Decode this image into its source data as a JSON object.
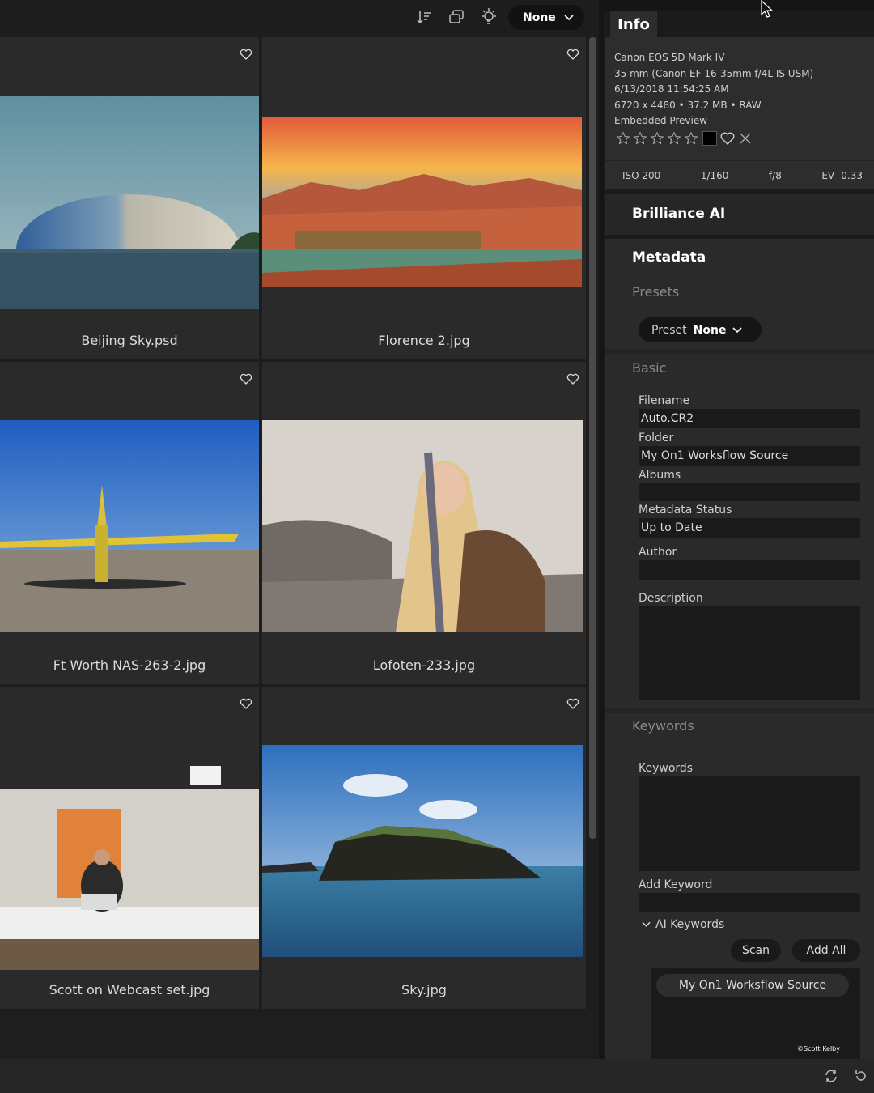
{
  "toolbar": {
    "sort_label": "None",
    "icons": [
      "sort-icon",
      "stack-icon",
      "lightbulb-icon",
      "chevron-down-icon"
    ]
  },
  "grid": {
    "items": [
      {
        "filename": "Beijing Sky.psd"
      },
      {
        "filename": "Florence 2.jpg"
      },
      {
        "filename": "Ft Worth NAS-263-2.jpg"
      },
      {
        "filename": "Lofoten-233.jpg"
      },
      {
        "filename": "Scott on Webcast set.jpg"
      },
      {
        "filename": "Sky.jpg"
      }
    ]
  },
  "info": {
    "tab_label": "Info",
    "camera": "Canon EOS 5D Mark IV",
    "lens": "35 mm (Canon EF 16-35mm f/4L IS USM)",
    "datetime": "6/13/2018 11:54:25 AM",
    "size": "6720 x 4480  •  37.2 MB  •  RAW",
    "preview": "Embedded Preview",
    "rating_stars": 0,
    "iso": "ISO 200",
    "shutter": "1/160",
    "aperture": "f/8",
    "ev": "EV -0.33"
  },
  "brilliance": {
    "title": "Brilliance AI"
  },
  "metadata": {
    "title": "Metadata",
    "presets_title": "Presets",
    "preset_label": "Preset",
    "preset_value": "None",
    "basic_title": "Basic",
    "filename_label": "Filename",
    "filename_value": "Auto.CR2",
    "folder_label": "Folder",
    "folder_value": "My On1 Worksflow Source",
    "albums_label": "Albums",
    "albums_value": "",
    "status_label": "Metadata Status",
    "status_value": "Up to Date",
    "author_label": "Author",
    "author_value": "",
    "description_label": "Description",
    "description_value": ""
  },
  "keywords": {
    "title": "Keywords",
    "keywords_label": "Keywords",
    "add_keyword_label": "Add Keyword",
    "ai_keywords_label": "AI Keywords",
    "scan_label": "Scan",
    "add_all_label": "Add All",
    "ai_chip": "My On1 Worksflow Source"
  },
  "credit": "©Scott Kelby"
}
